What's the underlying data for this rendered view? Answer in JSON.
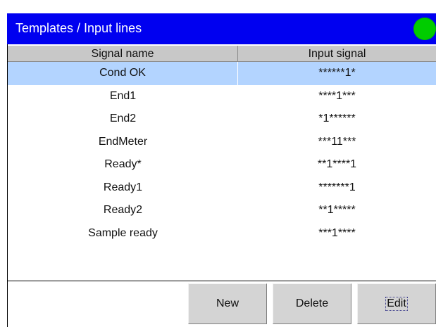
{
  "header": {
    "title": "Templates / Input lines",
    "status_color": "#00cc00"
  },
  "table": {
    "columns": [
      "Signal name",
      "Input signal"
    ],
    "selected_index": 0,
    "rows": [
      {
        "name": "Cond OK",
        "signal": "******1*"
      },
      {
        "name": "End1",
        "signal": "****1***"
      },
      {
        "name": "End2",
        "signal": "*1******"
      },
      {
        "name": "EndMeter",
        "signal": "***11***"
      },
      {
        "name": "Ready*",
        "signal": "**1****1"
      },
      {
        "name": "Ready1",
        "signal": "*******1"
      },
      {
        "name": "Ready2",
        "signal": "**1*****"
      },
      {
        "name": "Sample ready",
        "signal": "***1****"
      }
    ]
  },
  "buttons": {
    "new_label": "New",
    "delete_label": "Delete",
    "edit_label": "Edit"
  },
  "colors": {
    "header_bg": "#0000f0",
    "selected_row": "#b3d4ff",
    "button_bg": "#d4d4d4"
  }
}
